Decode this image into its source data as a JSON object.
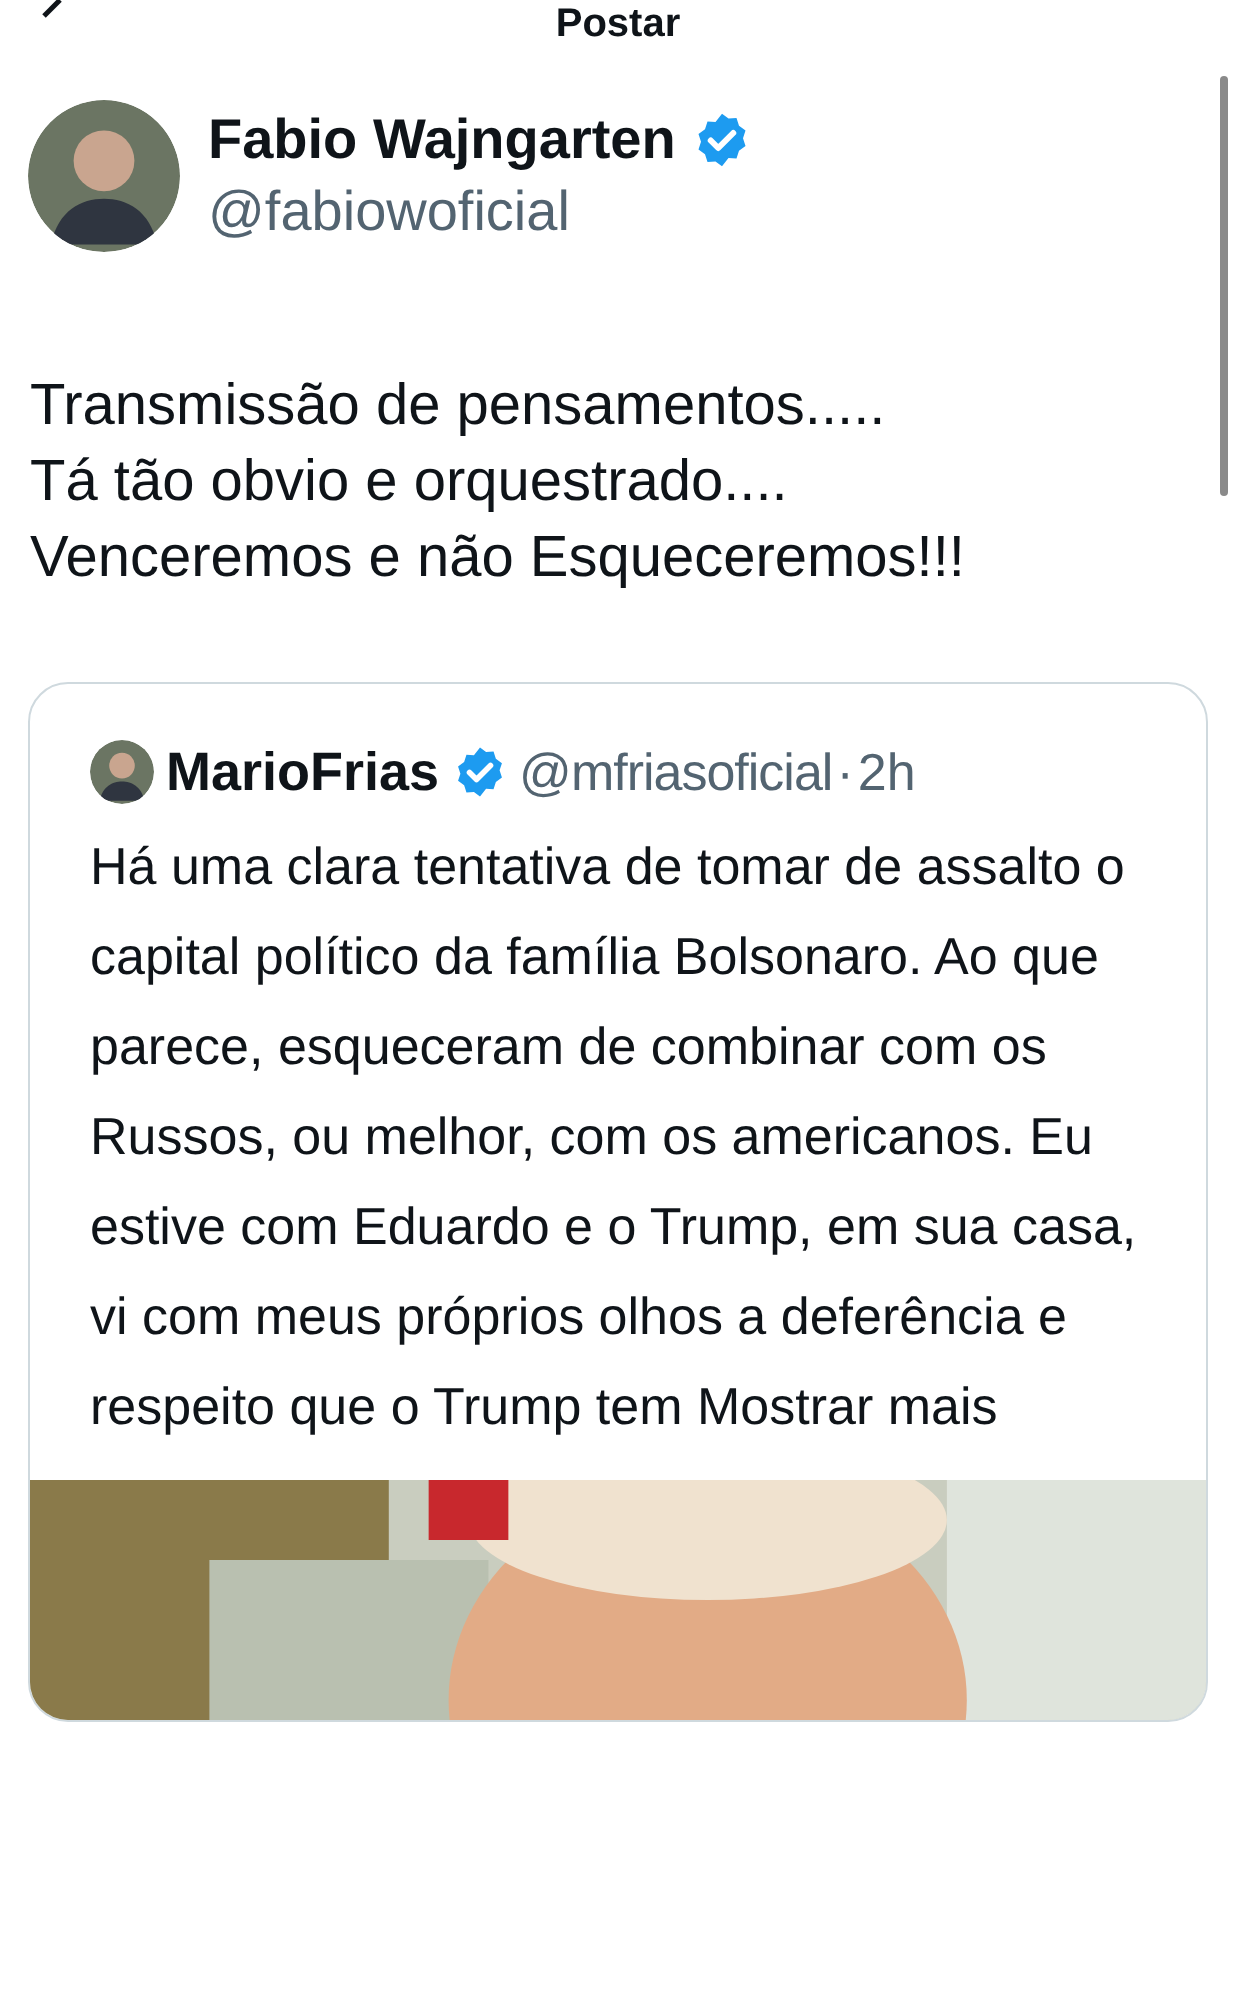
{
  "header": {
    "title": "Postar"
  },
  "author": {
    "name": "Fabio Wajngarten",
    "verified": true,
    "handle": "@fabiowoficial"
  },
  "post": {
    "text": "Transmissão de pensamentos.....\nTá tão obvio e orquestrado....\nVenceremos e não Esqueceremos!!!"
  },
  "quote": {
    "name": "MarioFrias",
    "verified": true,
    "handle": "@mfriasoficial",
    "separator": "·",
    "time": "2h",
    "text": "Há uma clara tentativa de tomar de assalto o capital político da família Bolsonaro. Ao que parece, esqueceram de combinar com os Russos, ou melhor, com os americanos. Eu estive com Eduardo e o Trump, em sua casa, vi com meus próprios olhos a deferência e respeito que o Trump tem",
    "more": "Mostrar mais"
  }
}
